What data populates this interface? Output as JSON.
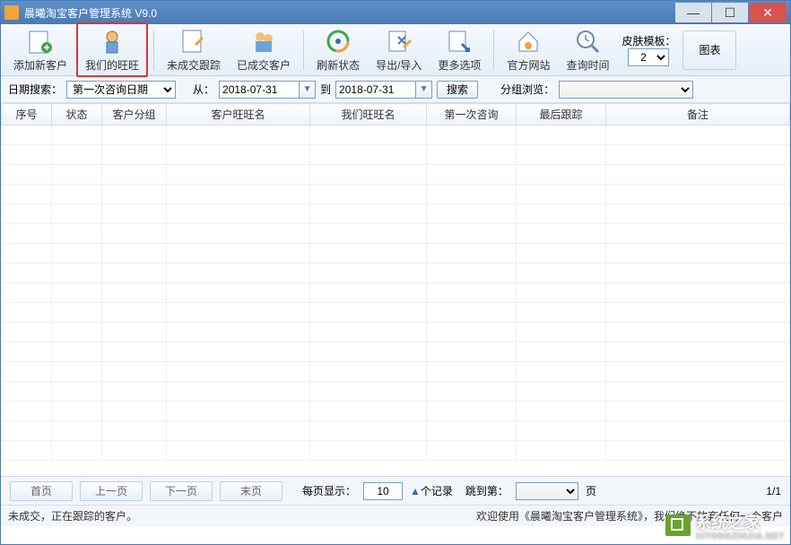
{
  "window": {
    "title": "晨曦淘宝客户管理系统 V9.0"
  },
  "toolbar": {
    "addCustomer": "添加新客户",
    "myWangwang": "我们的旺旺",
    "notTracked": "未成交跟踪",
    "dealtCustomer": "已成交客户",
    "refresh": "刷新状态",
    "importExport": "导出/导入",
    "moreOptions": "更多选项",
    "officialSite": "官方网站",
    "queryTime": "查询时间",
    "skinLabel": "皮肤模板：",
    "skinValue": "2",
    "chartBtn": "图表"
  },
  "searchbar": {
    "dateSearchLabel": "日期搜索：",
    "dateTypeValue": "第一次咨询日期",
    "fromLabel": "从：",
    "fromDate": "2018-07-31",
    "toLabel": "到",
    "toDate": "2018-07-31",
    "searchBtn": "搜索",
    "groupLabel": "分组浏览："
  },
  "table": {
    "headers": [
      "序号",
      "状态",
      "客户分组",
      "客户旺旺名",
      "我们旺旺名",
      "第一次咨询",
      "最后跟踪",
      "备注"
    ]
  },
  "pager": {
    "first": "首页",
    "prev": "上一页",
    "next": "下一页",
    "last": "末页",
    "perPageLabel": "每页显示：",
    "perPageValue": "10",
    "recordsLabel": "个记录",
    "jumpLabel": "跳到第：",
    "pageSuffix": "页",
    "pageInfo": "1/1"
  },
  "statusbar": {
    "left": "未成交，正在跟踪的客户。",
    "right": "欢迎使用《晨曦淘宝客户管理系统》，我们绝不放弃任何一个客户"
  },
  "watermark": {
    "main": "系统之家",
    "sub": "XITONGZHIJIA.NET"
  }
}
